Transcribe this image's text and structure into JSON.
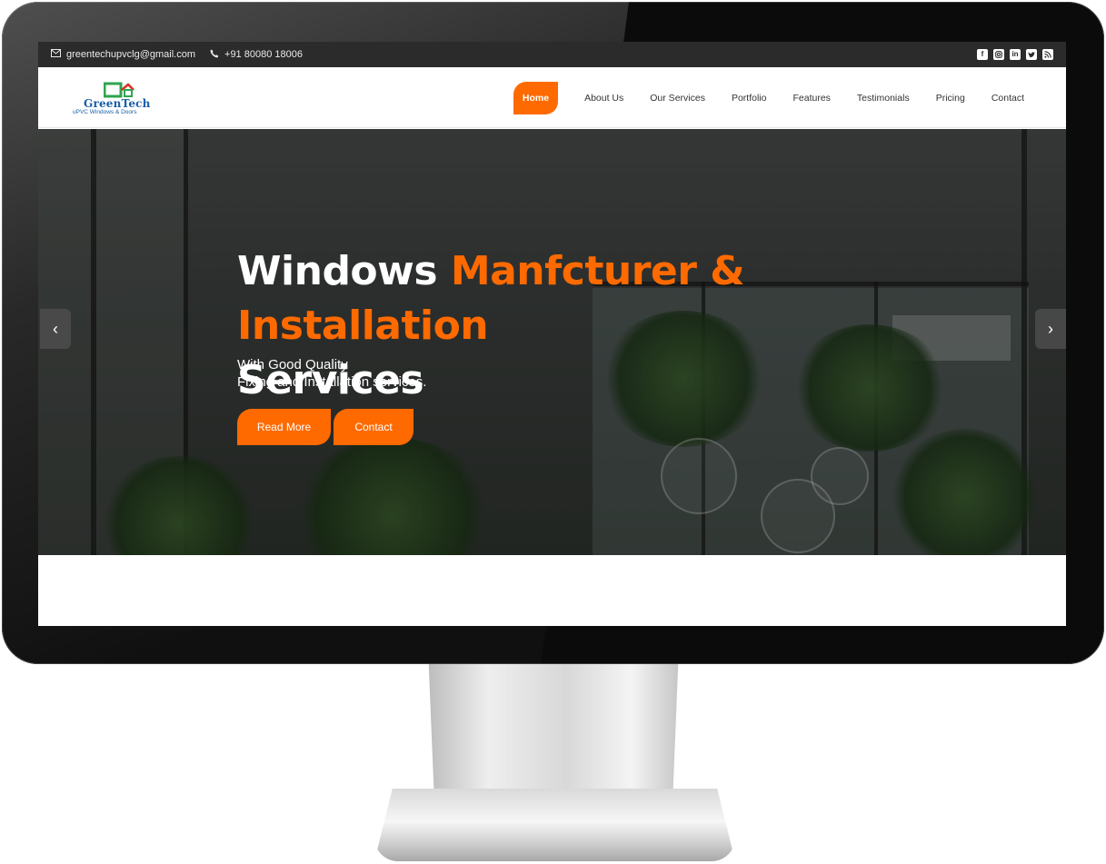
{
  "topbar": {
    "email": "greentechupvclg@gmail.com",
    "phone": "+91 80080 18006",
    "social_icons": [
      "facebook-icon",
      "instagram-icon",
      "linkedin-icon",
      "twitter-icon",
      "rss-icon"
    ]
  },
  "logo": {
    "name": "GreenTech",
    "tagline": "uPVC Windows & Doors"
  },
  "nav": {
    "items": [
      "Home",
      "About Us",
      "Our Services",
      "Portfolio",
      "Features",
      "Testimonials",
      "Pricing",
      "Contact"
    ],
    "active": "Home"
  },
  "hero": {
    "title_white_1": "Windows ",
    "title_accent": "Manfcturer & Installation",
    "title_white_2": "Services",
    "subtitle_line1": "With Good Quality",
    "subtitle_line2": "Fixing and Installation services.",
    "read_more_label": "Read More",
    "contact_label": "Contact",
    "prev_label": "‹",
    "next_label": "›"
  },
  "colors": {
    "accent": "#ff6a00",
    "topbar_bg": "#2b2b2b",
    "logo_blue": "#1b5fa8",
    "logo_green": "#2ea44f"
  }
}
